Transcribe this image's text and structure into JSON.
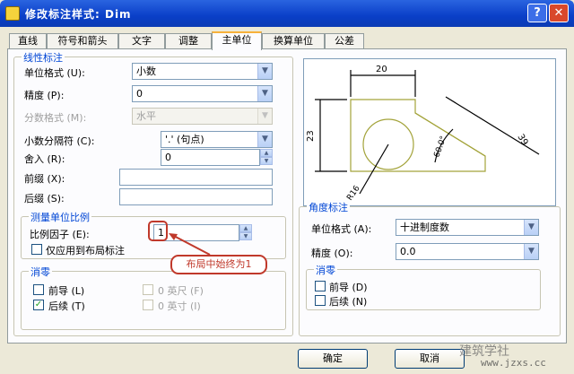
{
  "window": {
    "title": "修改标注样式: Dim",
    "help": "?",
    "close": "✕"
  },
  "tabs": [
    "直线",
    "符号和箭头",
    "文字",
    "调整",
    "主单位",
    "换算单位",
    "公差"
  ],
  "linear": {
    "group_title": "线性标注",
    "unit_format_label": "单位格式 (U):",
    "unit_format_value": "小数",
    "precision_label": "精度 (P):",
    "precision_value": "0",
    "fraction_format_label": "分数格式 (M):",
    "fraction_format_value": "水平",
    "decimal_sep_label": "小数分隔符 (C):",
    "decimal_sep_value": "'.' (句点)",
    "round_label": "舍入 (R):",
    "round_value": "0",
    "prefix_label": "前缀 (X):",
    "prefix_value": "",
    "suffix_label": "后缀 (S):",
    "suffix_value": ""
  },
  "scale": {
    "group_title": "测量单位比例",
    "factor_label": "比例因子 (E):",
    "factor_value": "1",
    "layout_only_label": "仅应用到布局标注"
  },
  "zero_linear": {
    "group_title": "消零",
    "leading_label": "前导 (L)",
    "trailing_label": "后续 (T)",
    "feet_label": "0 英尺 (F)",
    "inches_label": "0 英寸 (I)",
    "leading_checked": false,
    "trailing_checked": true
  },
  "angular": {
    "group_title": "角度标注",
    "unit_format_label": "单位格式 (A):",
    "unit_format_value": "十进制度数",
    "precision_label": "精度 (O):",
    "precision_value": "0.0",
    "zero_title": "消零",
    "leading_label": "前导 (D)",
    "trailing_label": "后续 (N)"
  },
  "preview": {
    "dim_top": "20",
    "dim_left": "23",
    "dim_right": "39",
    "dim_angle": "60.0°",
    "dim_radius": "R16"
  },
  "annotation": {
    "callout": "布局中始终为1"
  },
  "buttons": {
    "ok": "确定",
    "cancel": "取消"
  },
  "watermark": {
    "line1": "建筑学社",
    "line2": "www.jzxs.cc"
  },
  "icons": {
    "dropdown": "▼",
    "spin_up": "▲",
    "spin_down": "▼",
    "check": "✓"
  },
  "colors": {
    "title_bar": "#0a3fc8",
    "group_title": "#0046d5",
    "callout": "#c0392b",
    "preview_line": "#a3a33a"
  }
}
